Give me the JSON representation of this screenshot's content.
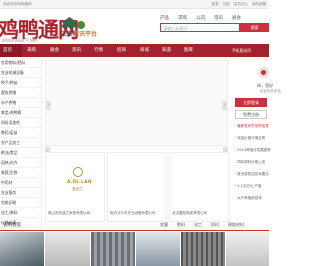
{
  "topbar": {
    "left": "欢迎来到鸡鸭通网！",
    "links": [
      "登录",
      "注册",
      "会员中心",
      "我的收藏"
    ]
  },
  "logo": {
    "text": "鸡鸭通网",
    "url": "WWW.WEHTT.NET"
  },
  "badge": {
    "text1": "三农",
    "text2": "资讯平台"
  },
  "search": {
    "tabs": [
      "产品",
      "求购",
      "公司",
      "资讯",
      "展会"
    ],
    "placeholder": "请输入关键词",
    "button": "搜索"
  },
  "nav": {
    "items": [
      "首页",
      "采购",
      "展会",
      "资讯",
      "行情",
      "招商",
      "商城",
      "知道",
      "图库"
    ],
    "mobile": "手机版访问"
  },
  "categories": [
    "农用物料/肥料",
    "农业机械设备",
    "种子/种苗",
    "畜牧养殖",
    "水产养殖",
    "禽类/鸡鸭鹅",
    "饲料添加剂",
    "兽药/疫苗",
    "农产品加工",
    "粮油/食品",
    "园林/花卉",
    "果蔬/生鲜",
    "中药材",
    "农业服务",
    "包装印刷",
    "化工/原料",
    "仪器仪表",
    "电子电工",
    "建材五金"
  ],
  "user": {
    "hi": "Hi，您好",
    "welcome": "欢迎来到本站",
    "login": "立即登录",
    "register": "免费注册"
  },
  "news": [
    {
      "text": "· 最新发布的采购信息",
      "red": true
    },
    {
      "text": "· 鸡苗价格行情走势",
      "red": false
    },
    {
      "text": "· 2024养殖业发展趋势",
      "red": false
    },
    {
      "text": "· 饲料原料价格上涨",
      "red": false
    },
    {
      "text": "· 禽流感防控技术要点",
      "red": false
    },
    {
      "text": "· 0.1万亿元 产值",
      "red": false
    },
    {
      "text": "· 水产养殖新技术",
      "red": false
    }
  ],
  "cards": [
    {
      "logo_name": "A.DI.LAN",
      "logo_sub": "爱迪兰",
      "caption": "佛山市阿迪兰家具有限公司"
    },
    {
      "logo_name": "",
      "logo_sub": "",
      "caption": "临沂沃尔丰农业设备有限公司"
    },
    {
      "logo_name": "",
      "logo_sub": "",
      "caption": "武汉晨阳电缆有限公司"
    }
  ],
  "section": {
    "title": "农用物资",
    "tabs": [
      "农膜",
      "肥料",
      "化工",
      "饲料",
      "建筑材料"
    ]
  },
  "colors": {
    "brand": "#a3222f",
    "accent": "#c9313c"
  }
}
